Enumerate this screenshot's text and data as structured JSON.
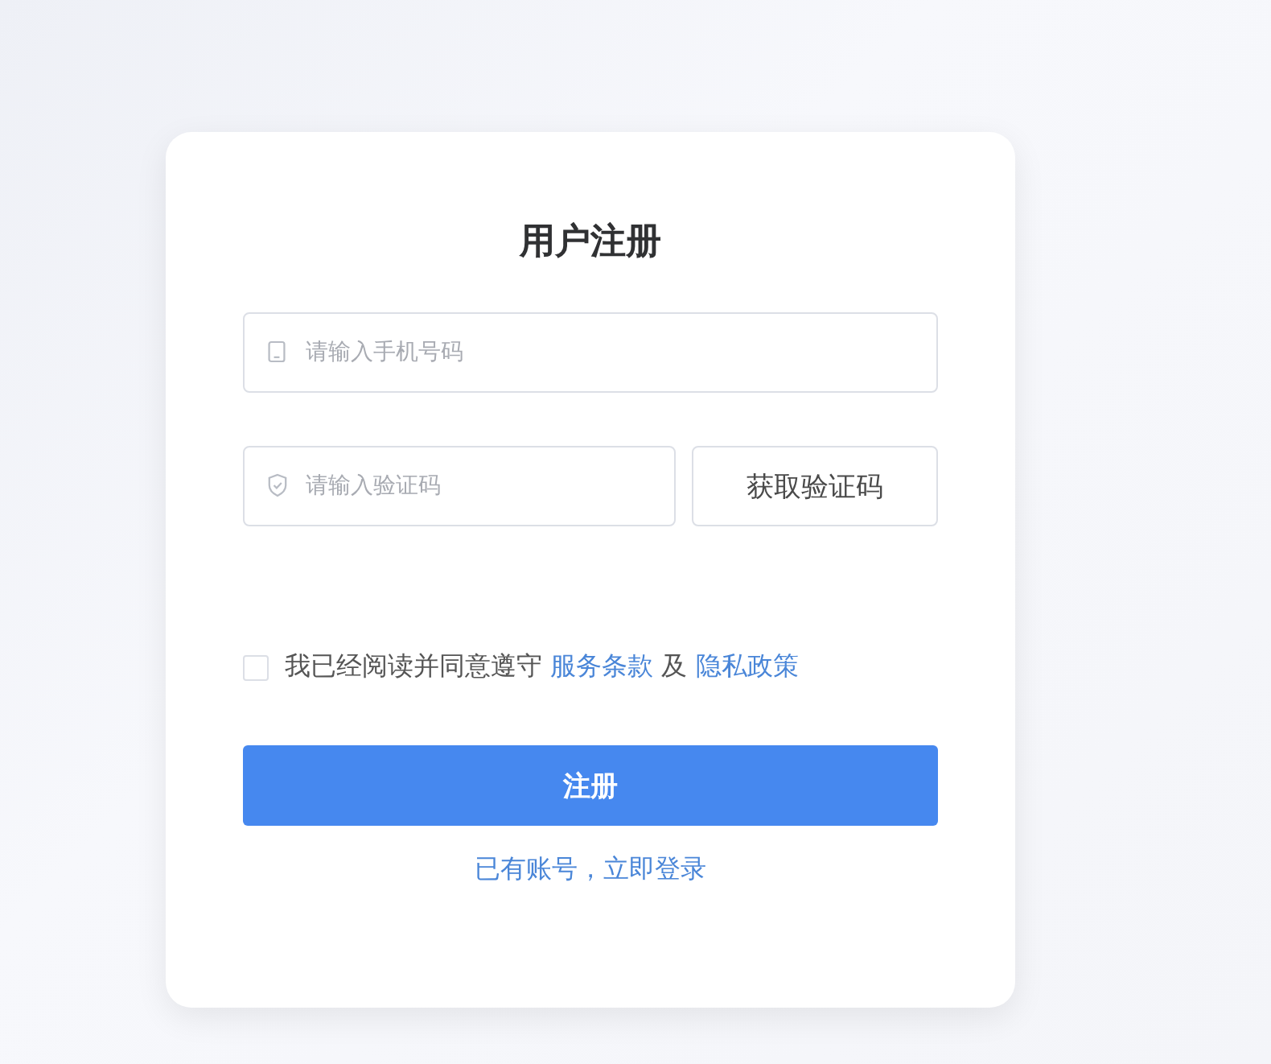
{
  "form": {
    "title": "用户注册",
    "phone": {
      "placeholder": "请输入手机号码"
    },
    "code": {
      "placeholder": "请输入验证码"
    },
    "send_code_button": "获取验证码",
    "agreement": {
      "checked": false,
      "text": "我已经阅读并同意遵守",
      "terms_link": "服务条款",
      "conjunction": "及",
      "privacy_link": "隐私政策"
    },
    "submit_button": "注册",
    "login_link": "已有账号，立即登录"
  }
}
